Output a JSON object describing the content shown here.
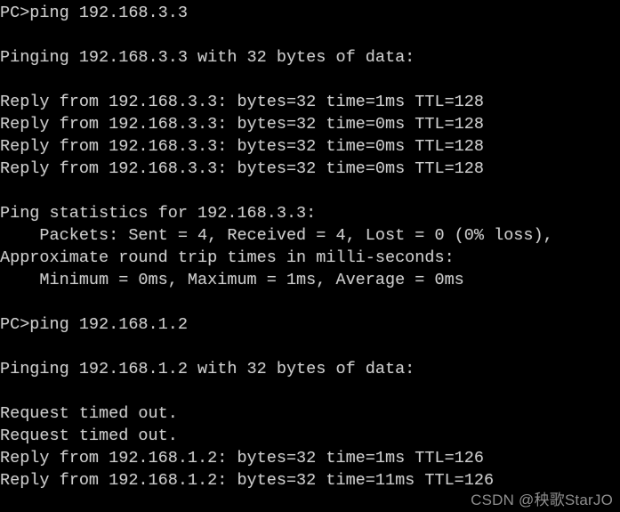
{
  "terminal": {
    "background_color": "#000000",
    "text_color": "#cccccc",
    "lines": [
      "PC>ping 192.168.3.3",
      "",
      "Pinging 192.168.3.3 with 32 bytes of data:",
      "",
      "Reply from 192.168.3.3: bytes=32 time=1ms TTL=128",
      "Reply from 192.168.3.3: bytes=32 time=0ms TTL=128",
      "Reply from 192.168.3.3: bytes=32 time=0ms TTL=128",
      "Reply from 192.168.3.3: bytes=32 time=0ms TTL=128",
      "",
      "Ping statistics for 192.168.3.3:",
      "    Packets: Sent = 4, Received = 4, Lost = 0 (0% loss),",
      "Approximate round trip times in milli-seconds:",
      "    Minimum = 0ms, Maximum = 1ms, Average = 0ms",
      "",
      "PC>ping 192.168.1.2",
      "",
      "Pinging 192.168.1.2 with 32 bytes of data:",
      "",
      "Request timed out.",
      "Request timed out.",
      "Reply from 192.168.1.2: bytes=32 time=1ms TTL=126",
      "Reply from 192.168.1.2: bytes=32 time=11ms TTL=126"
    ]
  },
  "watermark": {
    "text": "CSDN @秧歌StarJO",
    "color": "#8e8e8e"
  }
}
